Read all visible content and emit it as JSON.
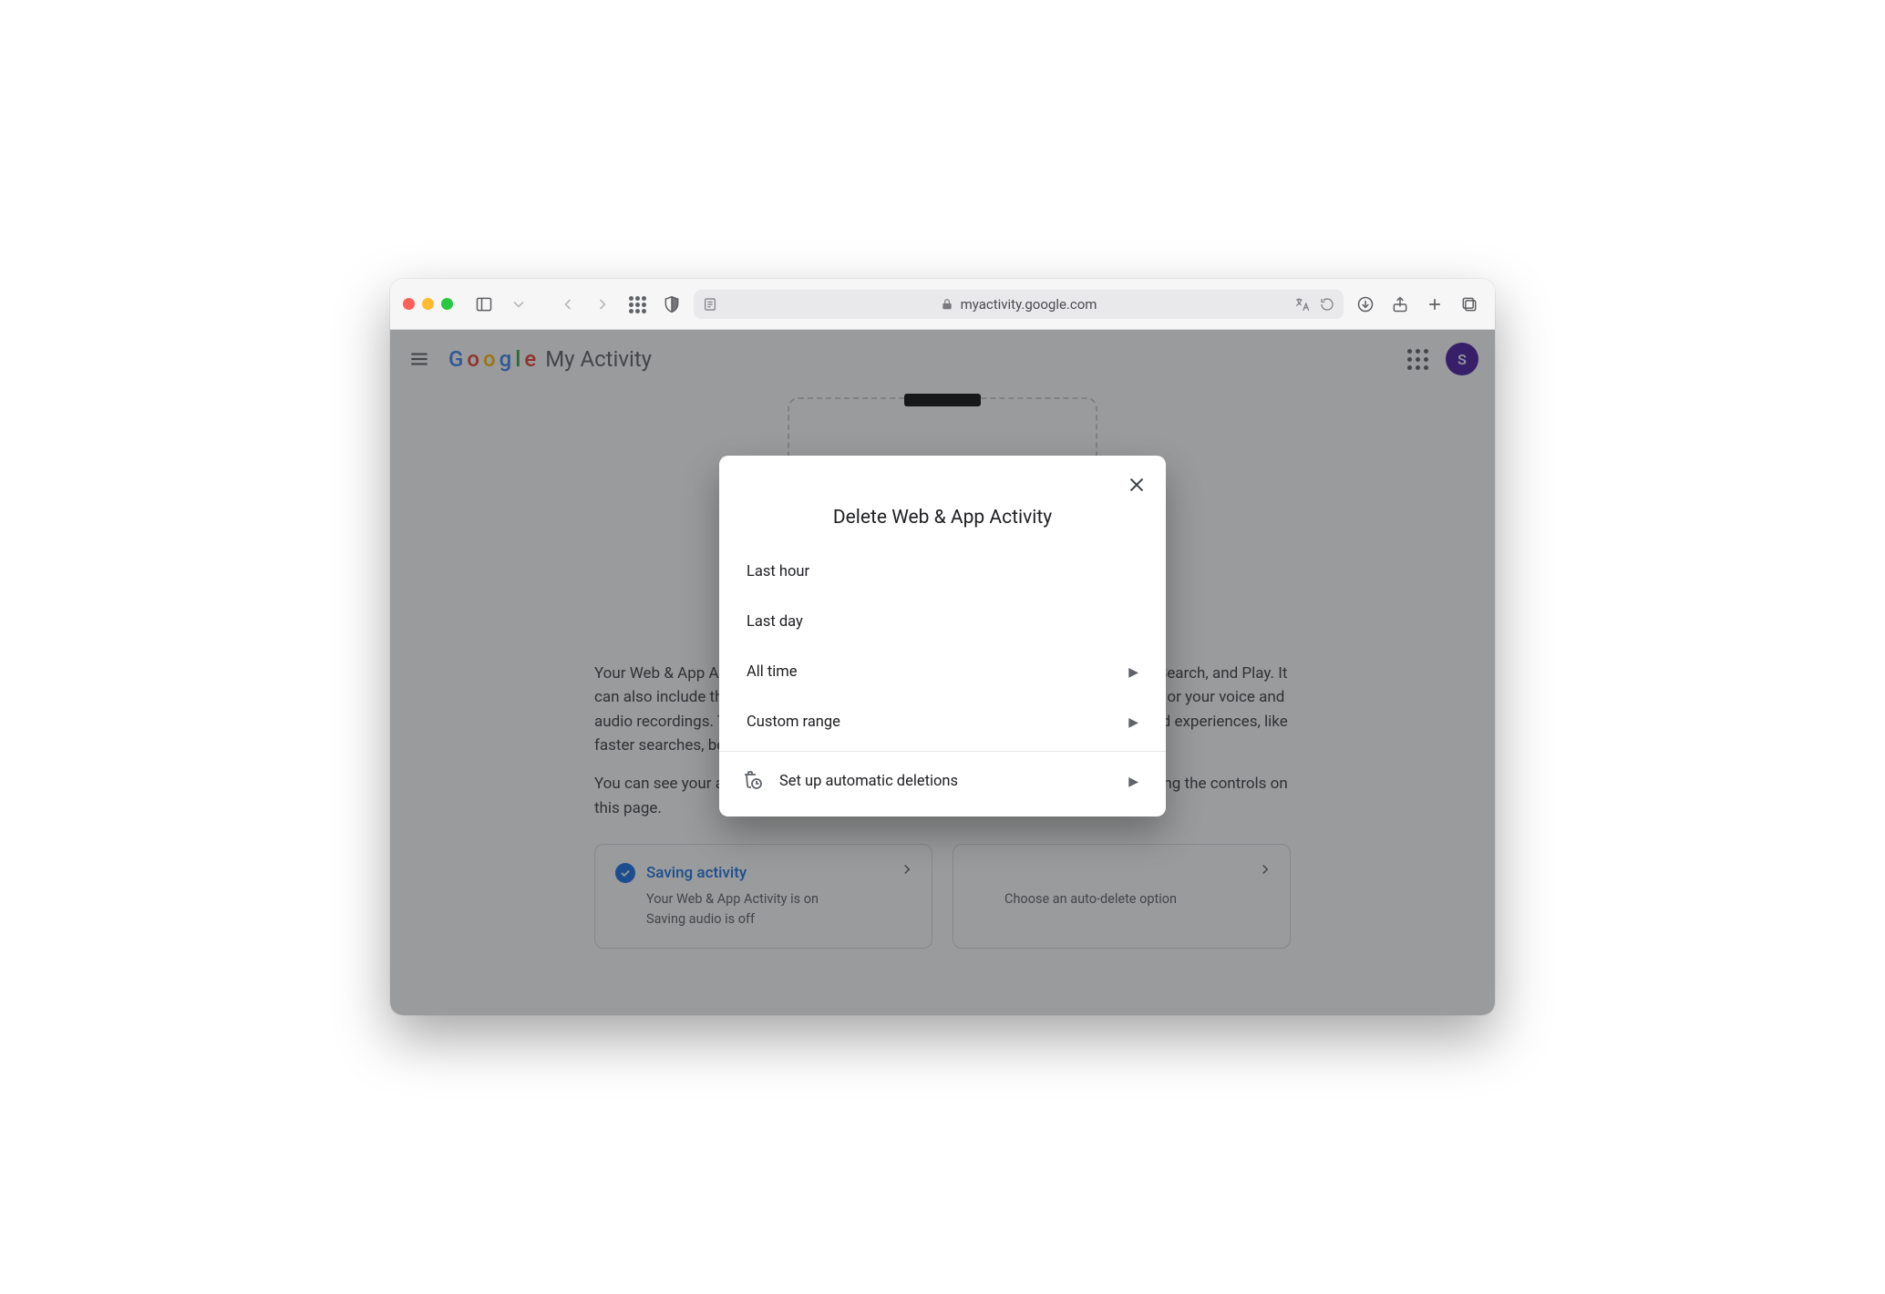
{
  "browser": {
    "url": "myactivity.google.com"
  },
  "appbar": {
    "brand_prefix_letters": [
      "G",
      "o",
      "o",
      "g",
      "l",
      "e"
    ],
    "brand_suffix": "My Activity",
    "avatar_initial": "S"
  },
  "page": {
    "para1": "Your Web & App Activity includes the things you do on Google services, like Maps, Search, and Play. It can also include things you do on sites, apps, and devices that use Google services or your voice and audio recordings. This activity makes Google services more useful and personalized experiences, like faster searches, better recommendations, and more helpful suggestions.",
    "para2": "You can see your activity, delete it manually, or choose to delete it automatically using the controls on this page."
  },
  "cards": {
    "saving": {
      "title": "Saving activity",
      "line1": "Your Web & App Activity is on",
      "line2": "Saving audio is off"
    },
    "autodelete": {
      "sub": "Choose an auto-delete option"
    }
  },
  "dialog": {
    "title": "Delete Web & App Activity",
    "options": {
      "last_hour": "Last hour",
      "last_day": "Last day",
      "all_time": "All time",
      "custom_range": "Custom range",
      "auto": "Set up automatic deletions"
    }
  }
}
